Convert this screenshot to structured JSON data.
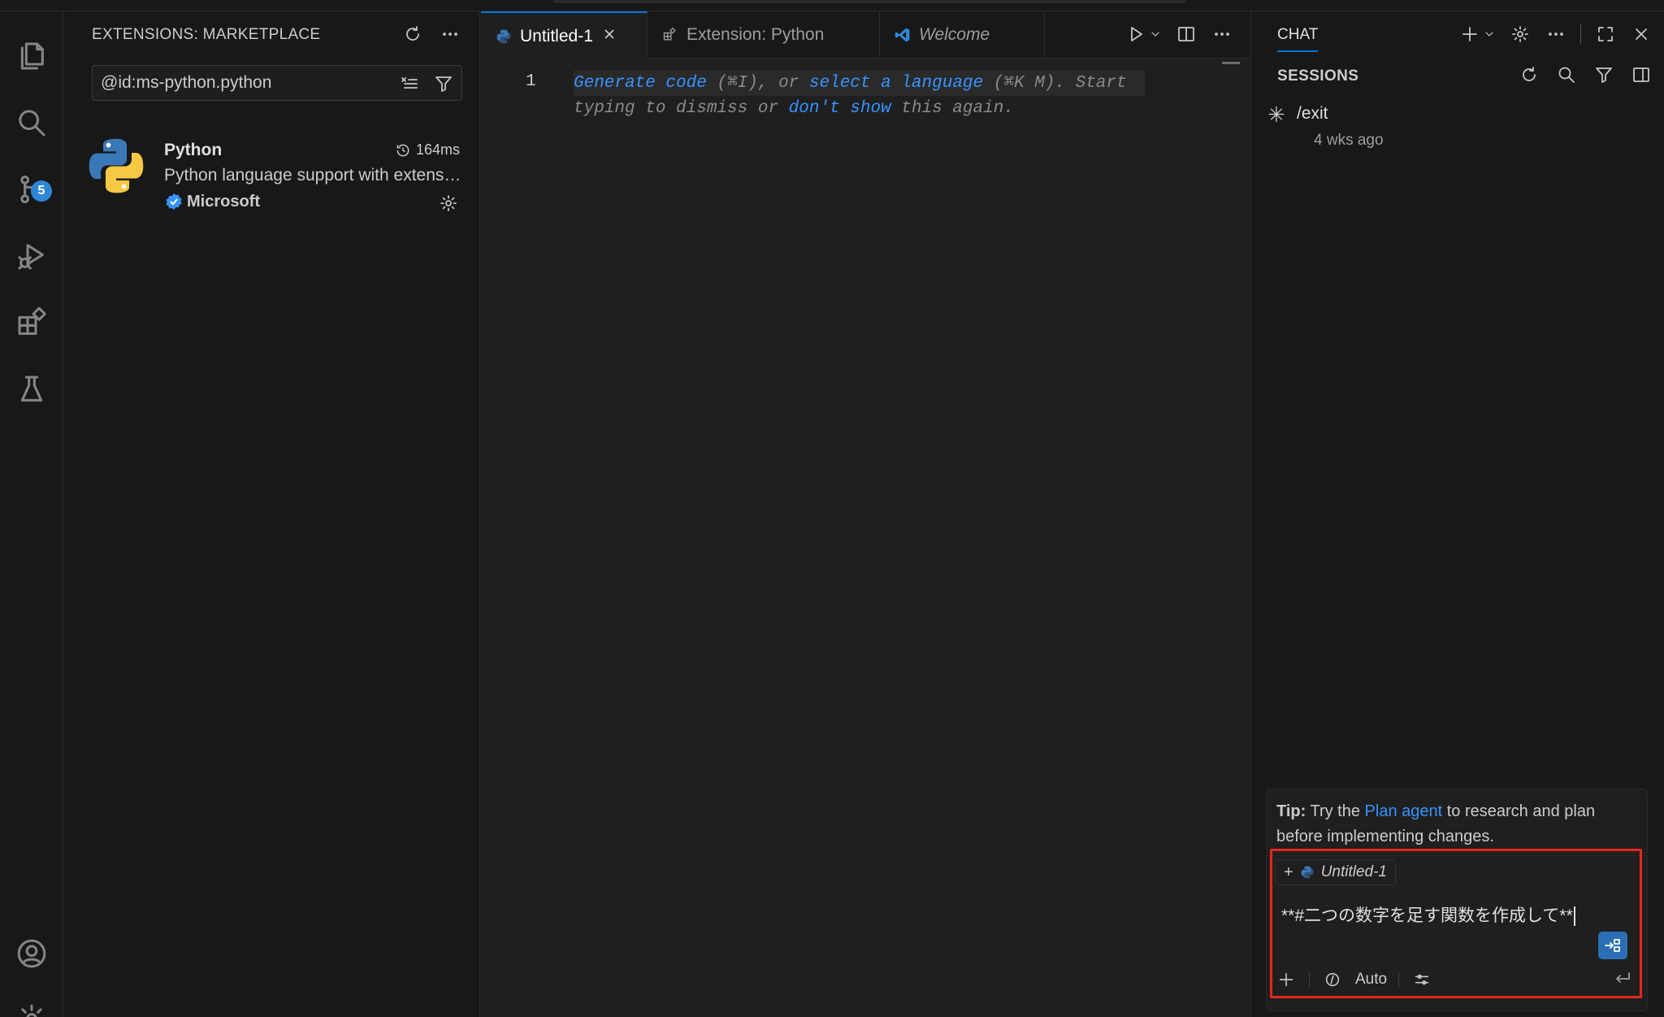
{
  "activity_bar": {
    "items": [
      {
        "name": "explorer",
        "icon": "files-icon"
      },
      {
        "name": "search",
        "icon": "search-icon"
      },
      {
        "name": "source-control",
        "icon": "source-control-icon",
        "badge": "5"
      },
      {
        "name": "run-debug",
        "icon": "run-debug-icon"
      },
      {
        "name": "extensions",
        "icon": "extensions-icon"
      },
      {
        "name": "testing",
        "icon": "beaker-icon"
      }
    ],
    "bottom": [
      {
        "name": "accounts",
        "icon": "account-icon"
      },
      {
        "name": "manage",
        "icon": "gear-icon"
      }
    ]
  },
  "sidebar": {
    "title": "EXTENSIONS: MARKETPLACE",
    "search_value": "@id:ms-python.python",
    "extension": {
      "name": "Python",
      "time": "164ms",
      "description": "Python language support with extension access points for IntelliSense (Pylance), Debugging (Python Debugger), linting, formatting, refactoring, unit tests, and more.",
      "publisher": "Microsoft"
    }
  },
  "editor": {
    "tabs": [
      {
        "label": "Untitled-1",
        "active": true
      },
      {
        "label": "Extension: Python",
        "active": false
      },
      {
        "label": "Welcome",
        "active": false
      }
    ],
    "line_number": "1",
    "hint": {
      "generate": "Generate code",
      "gen_key": " (⌘I), or ",
      "select": "select a language",
      "sel_key": " (⌘K M). Start",
      "line2_pre": "typing to dismiss or ",
      "dont_show": "don't show",
      "line2_post": " this again."
    }
  },
  "chat": {
    "tab_label": "CHAT",
    "sessions_title": "SESSIONS",
    "session": {
      "title": "/exit",
      "time": "4 wks ago"
    },
    "tip": {
      "label": "Tip:",
      "pre": " Try the ",
      "link": "Plan agent",
      "post": " to research and plan before implementing changes."
    },
    "context_chip": "Untitled-1",
    "prompt": "**#二つの数字を足す関数を作成して**",
    "mode": "Auto"
  },
  "colors": {
    "accent": "#0078d4",
    "link": "#3794ff",
    "highlight_box": "#e8261d",
    "badge": "#2f86d6"
  }
}
